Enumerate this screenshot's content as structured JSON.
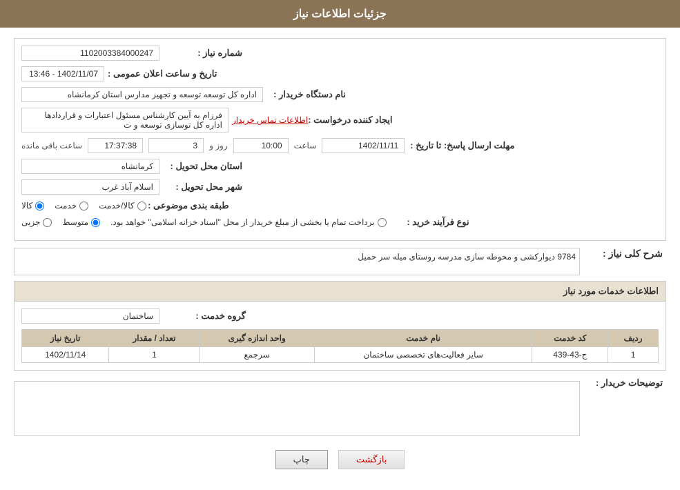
{
  "header": {
    "title": "جزئیات اطلاعات نیاز"
  },
  "main_info": {
    "need_number_label": "شماره نیاز :",
    "need_number_value": "1102003384000247",
    "org_label": "نام دستگاه خریدار :",
    "org_value": "اداره کل توسعه  توسعه و تجهیز مدارس استان کرمانشاه",
    "creator_label": "ایجاد کننده درخواست :",
    "creator_value": "فرزام به آیین کارشناس مسئول اعتبارات و قراردادها اداره کل توسازی  توسعه و ت",
    "creator_link": "اطلاعات تماس خریدار",
    "date_label": "تاریخ و ساعت اعلان عمومی :",
    "date_value": "1402/11/07 - 13:46",
    "reply_deadline_label": "مهلت ارسال پاسخ: تا تاریخ :",
    "reply_date": "1402/11/11",
    "reply_time_label": "ساعت",
    "reply_time": "10:00",
    "reply_day_label": "روز و",
    "reply_days": "3",
    "reply_remaining_label": "ساعت باقی مانده",
    "reply_remaining": "17:37:38",
    "province_label": "استان محل تحویل :",
    "province_value": "کرمانشاه",
    "city_label": "شهر محل تحویل :",
    "city_value": "اسلام آباد غرب",
    "category_label": "طبقه بندی موضوعی :",
    "category_options": [
      "کالا",
      "خدمت",
      "کالا/خدمت"
    ],
    "category_selected": "کالا",
    "process_label": "نوع فرآیند خرید :",
    "process_options": [
      "جزیی",
      "متوسط",
      "برداخت تمام یا بخشی از مبلغ خریدار از محل \"اسناد خزانه اسلامی\" خواهد بود."
    ],
    "process_selected": "متوسط"
  },
  "description_section": {
    "title": "شرح کلی نیاز :",
    "value": "9784 دیوارکشی و محوطه سازی مدرسه روستای میله سر حمیل"
  },
  "services_section": {
    "title": "اطلاعات خدمات مورد نیاز",
    "group_label": "گروه خدمت :",
    "group_value": "ساختمان",
    "table_headers": [
      "ردیف",
      "کد خدمت",
      "نام خدمت",
      "واحد اندازه گیری",
      "تعداد / مقدار",
      "تاریخ نیاز"
    ],
    "table_rows": [
      {
        "row": "1",
        "code": "ج-43-439",
        "name": "سایر فعالیت‌های تخصصی ساختمان",
        "unit": "سرجمع",
        "qty": "1",
        "date": "1402/11/14"
      }
    ]
  },
  "buyer_note": {
    "label": "توضیحات خریدار :",
    "value": ""
  },
  "buttons": {
    "print": "چاپ",
    "back": "بازگشت"
  }
}
